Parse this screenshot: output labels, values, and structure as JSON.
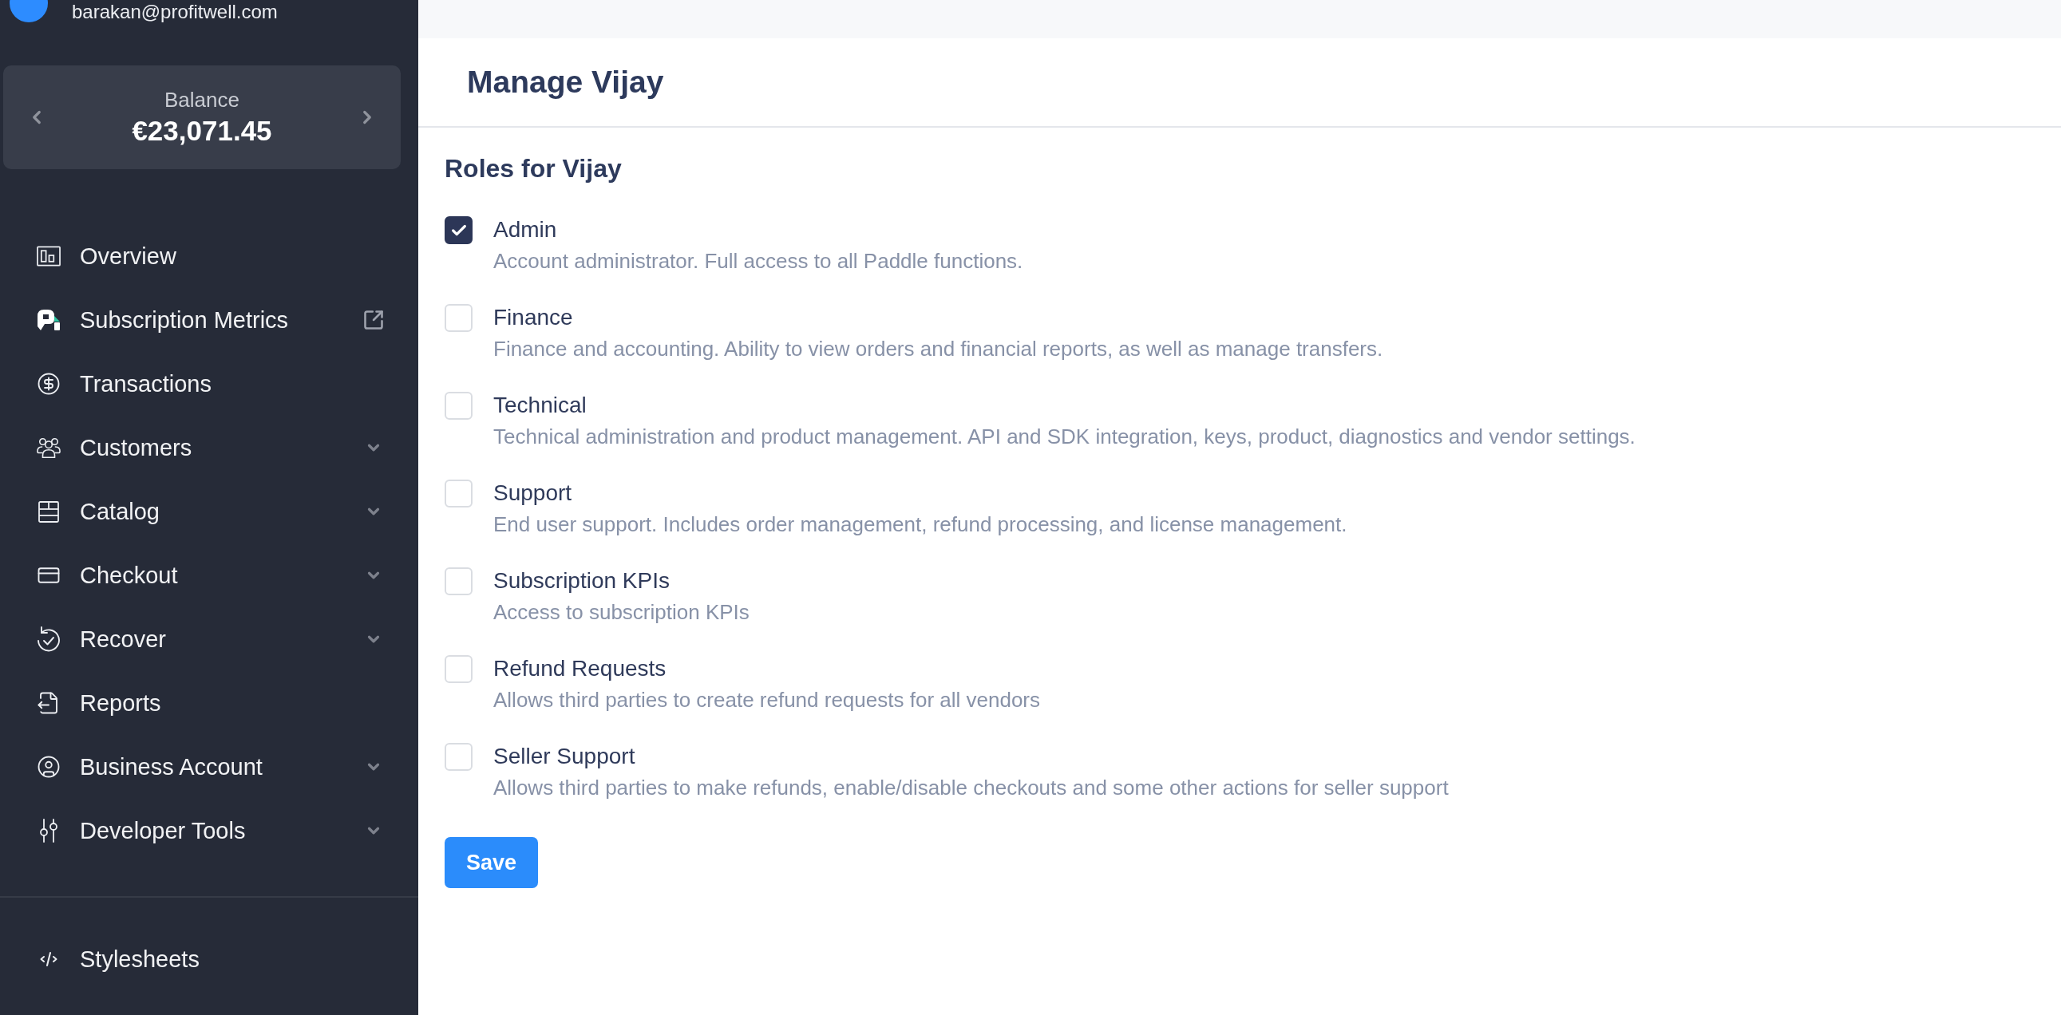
{
  "account": {
    "email": "barakan@profitwell.com"
  },
  "balance": {
    "label": "Balance",
    "amount": "€23,071.45"
  },
  "sidebar": {
    "items": [
      {
        "label": "Overview",
        "kind": "link"
      },
      {
        "label": "Subscription Metrics",
        "kind": "external"
      },
      {
        "label": "Transactions",
        "kind": "link"
      },
      {
        "label": "Customers",
        "kind": "group",
        "expanded": false
      },
      {
        "label": "Catalog",
        "kind": "group",
        "expanded": false
      },
      {
        "label": "Checkout",
        "kind": "group",
        "expanded": false
      },
      {
        "label": "Recover",
        "kind": "group",
        "expanded": false
      },
      {
        "label": "Reports",
        "kind": "link"
      },
      {
        "label": "Business Account",
        "kind": "group",
        "expanded": false
      },
      {
        "label": "Developer Tools",
        "kind": "group",
        "expanded": false
      }
    ],
    "footer_items": [
      {
        "label": "Stylesheets"
      }
    ]
  },
  "page": {
    "title": "Manage Vijay"
  },
  "roles": {
    "title": "Roles for Vijay",
    "items": [
      {
        "name": "Admin",
        "description": "Account administrator. Full access to all Paddle functions.",
        "checked": true
      },
      {
        "name": "Finance",
        "description": "Finance and accounting. Ability to view orders and financial reports, as well as manage transfers.",
        "checked": false
      },
      {
        "name": "Technical",
        "description": "Technical administration and product management. API and SDK integration, keys, product, diagnostics and vendor settings.",
        "checked": false
      },
      {
        "name": "Support",
        "description": "End user support. Includes order management, refund processing, and license management.",
        "checked": false
      },
      {
        "name": "Subscription KPIs",
        "description": "Access to subscription KPIs",
        "checked": false
      },
      {
        "name": "Refund Requests",
        "description": "Allows third parties to create refund requests for all vendors",
        "checked": false
      },
      {
        "name": "Seller Support",
        "description": "Allows third parties to make refunds, enable/disable checkouts and some other actions for seller support",
        "checked": false
      }
    ]
  },
  "save_button": {
    "label": "Save"
  }
}
